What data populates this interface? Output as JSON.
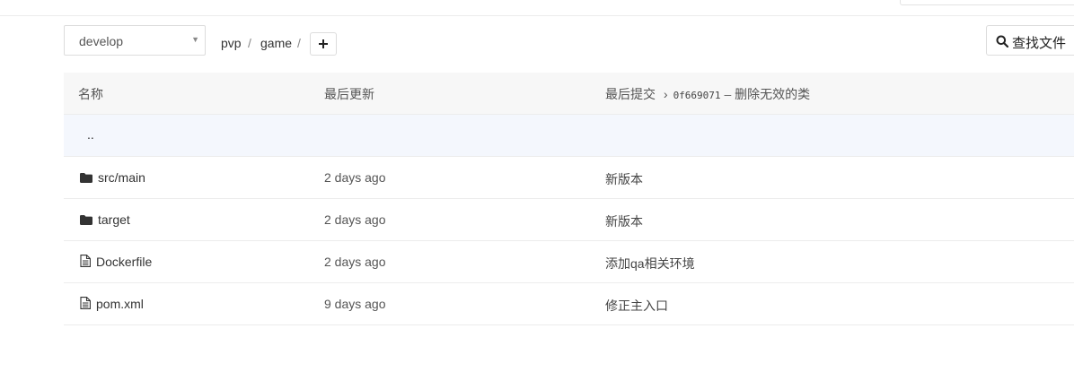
{
  "toolbar": {
    "branch": "develop",
    "breadcrumb": [
      "pvp",
      "game"
    ],
    "breadcrumb_separator": "/",
    "find_file_label": "查找文件"
  },
  "table": {
    "headers": {
      "name": "名称",
      "last_update": "最后更新",
      "last_commit": "最后提交",
      "commit_sha": "0f669071",
      "commit_separator": "–",
      "commit_message": "删除无效的类"
    },
    "parent_dir": "..",
    "rows": [
      {
        "type": "folder",
        "icon": "folder-icon",
        "name": "src/main",
        "date": "2 days ago",
        "message": "新版本"
      },
      {
        "type": "folder",
        "icon": "folder-icon",
        "name": "target",
        "date": "2 days ago",
        "message": "新版本"
      },
      {
        "type": "file",
        "icon": "file-icon",
        "name": "Dockerfile",
        "date": "2 days ago",
        "message": "添加qa相关环境"
      },
      {
        "type": "file",
        "icon": "file-icon",
        "name": "pom.xml",
        "date": "9 days ago",
        "message": "修正主入口"
      }
    ]
  },
  "colors": {
    "header_bg": "#f7f7f7",
    "parent_row_bg": "#f4f7fd",
    "border": "#ececec"
  }
}
